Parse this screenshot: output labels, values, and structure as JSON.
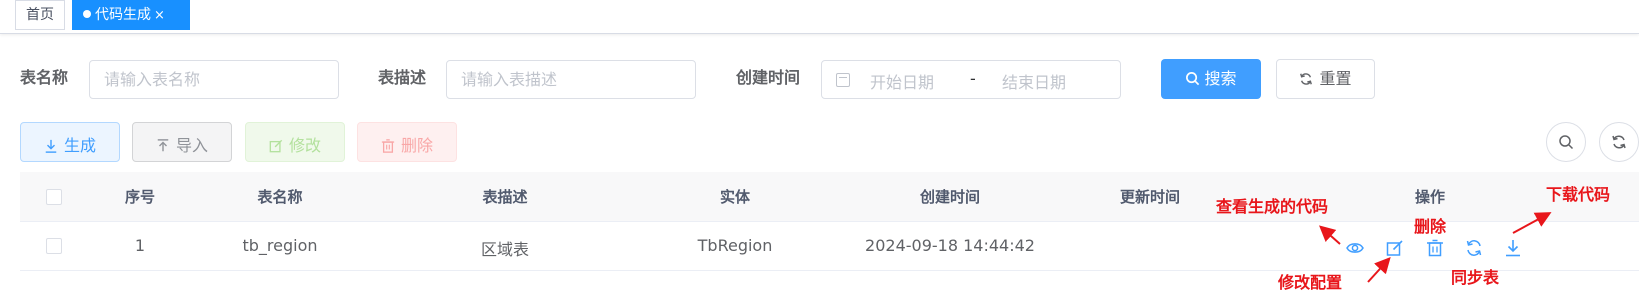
{
  "tags": {
    "home": "首页",
    "active": "代码生成",
    "close": "×"
  },
  "form": {
    "table_name_label": "表名称",
    "table_name_placeholder": "请输入表名称",
    "table_desc_label": "表描述",
    "table_desc_placeholder": "请输入表描述",
    "created_label": "创建时间",
    "start_placeholder": "开始日期",
    "range_sep": "-",
    "end_placeholder": "结束日期",
    "search": "搜索",
    "reset": "重置"
  },
  "toolbar": {
    "generate": "生成",
    "import": "导入",
    "edit": "修改",
    "delete": "删除"
  },
  "table": {
    "headers": [
      "序号",
      "表名称",
      "表描述",
      "实体",
      "创建时间",
      "更新时间",
      "操作"
    ],
    "rows": [
      {
        "index": "1",
        "table_name": "tb_region",
        "table_desc": "区域表",
        "entity": "TbRegion",
        "created": "2024-09-18 14:44:42",
        "updated": ""
      }
    ]
  },
  "annotations": {
    "preview": "查看生成的代码",
    "edit_config": "修改配置",
    "delete": "删除",
    "sync": "同步表",
    "download": "下载代码"
  },
  "colors": {
    "primary": "#409eff",
    "active_tag": "#1890ff",
    "annotation": "#e8161b"
  }
}
